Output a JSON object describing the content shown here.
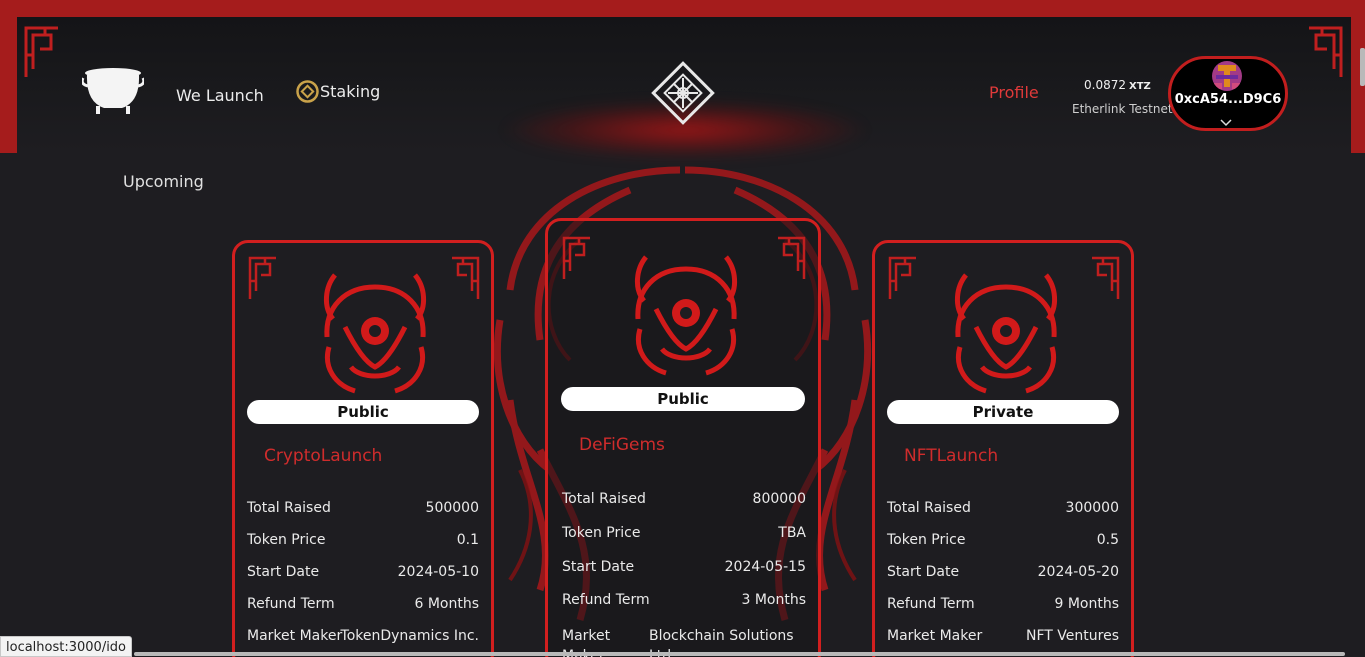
{
  "nav": {
    "we_launch": "We Launch",
    "staking": "Staking",
    "profile": "Profile"
  },
  "wallet": {
    "balance": "0.0872",
    "unit": "XTZ",
    "network": "Etherlink Testnet",
    "address": "0xcA54...D9C6"
  },
  "section": {
    "title": "Upcoming"
  },
  "cards": [
    {
      "type": "Public",
      "name": "CryptoLaunch",
      "rows": [
        {
          "label": "Total Raised",
          "value": "500000"
        },
        {
          "label": "Token Price",
          "value": "0.1"
        },
        {
          "label": "Start Date",
          "value": "2024-05-10"
        },
        {
          "label": "Refund Term",
          "value": "6 Months"
        },
        {
          "label": "Market Maker",
          "value": "TokenDynamics Inc."
        }
      ]
    },
    {
      "type": "Public",
      "name": "DeFiGems",
      "rows": [
        {
          "label": "Total Raised",
          "value": "800000"
        },
        {
          "label": "Token Price",
          "value": "TBA"
        },
        {
          "label": "Start Date",
          "value": "2024-05-15"
        },
        {
          "label": "Refund Term",
          "value": "3 Months"
        },
        {
          "label": "Market Maker",
          "value": "Blockchain Solutions Ltd."
        }
      ]
    },
    {
      "type": "Private",
      "name": "NFTLaunch",
      "rows": [
        {
          "label": "Total Raised",
          "value": "300000"
        },
        {
          "label": "Token Price",
          "value": "0.5"
        },
        {
          "label": "Start Date",
          "value": "2024-05-20"
        },
        {
          "label": "Refund Term",
          "value": "9 Months"
        },
        {
          "label": "Market Maker",
          "value": "NFT Ventures"
        }
      ]
    }
  ],
  "browser": {
    "status_url": "localhost:3000/ido"
  },
  "colors": {
    "accent_red": "#d21f1f",
    "background": "#1e1d21"
  }
}
